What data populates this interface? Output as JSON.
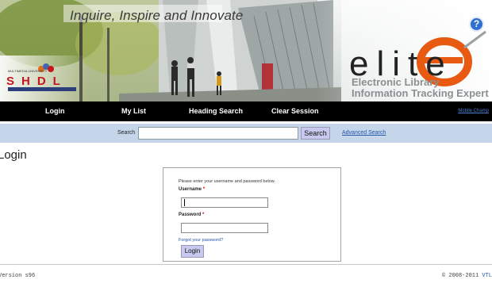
{
  "banner": {
    "tagline": "Inquire, Inspire and Innovate",
    "library_logo": {
      "university": "MULTIMEDIA UNIVERSITY",
      "acronym": "SHDL"
    },
    "product_logo": {
      "word": "elite",
      "subtitle_line1": "Electronic Library",
      "subtitle_line2": "Information Tracking Expert"
    },
    "help_icon": "help-icon"
  },
  "nav": {
    "items": [
      {
        "label": "Login"
      },
      {
        "label": "My List"
      },
      {
        "label": "Heading Search"
      },
      {
        "label": "Clear Session"
      }
    ],
    "mobile_link": "Mobile Champ"
  },
  "search": {
    "label": "Search",
    "value": "",
    "button": "Search",
    "advanced_link": "Advanced Search"
  },
  "page": {
    "title": "Login"
  },
  "login": {
    "intro": "Please enter your username and password below.",
    "username_label": "Username",
    "password_label": "Password",
    "required_mark": "*",
    "username_value": "",
    "password_value": "",
    "forgot_link": "Forgot your password?",
    "button": "Login"
  },
  "footer": {
    "version": "Version s96",
    "copyright": "© 2008-2011",
    "vendor": "VTL"
  },
  "colors": {
    "nav_bg": "#000000",
    "search_bar_bg": "#c6d6ea",
    "button_bg": "#c9c8ee",
    "link": "#2255aa",
    "logo_accent": "#e85a12",
    "required": "#dd0000"
  }
}
